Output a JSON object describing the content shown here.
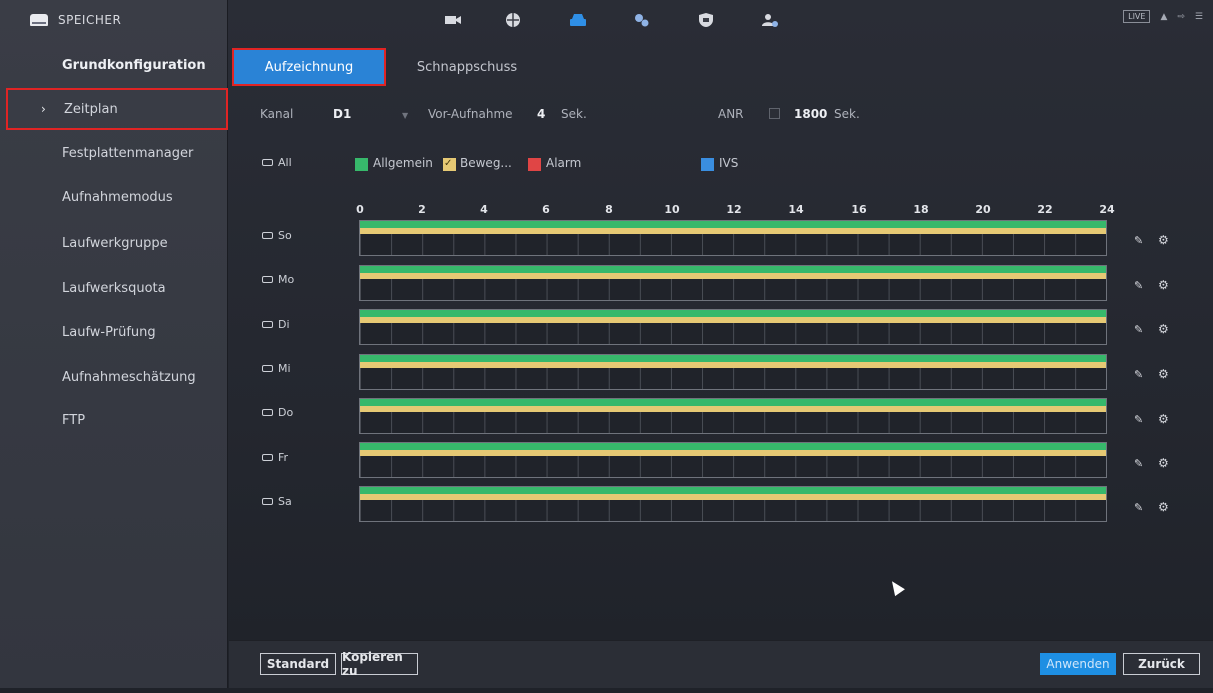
{
  "sidebar": {
    "section_title": "SPEICHER",
    "items": [
      {
        "label": "Grundkonfiguration"
      },
      {
        "label": "Zeitplan"
      },
      {
        "label": "Festplattenmanager"
      },
      {
        "label": "Aufnahmemodus"
      },
      {
        "label": "Laufwerkgruppe"
      },
      {
        "label": "Laufwerksquota"
      },
      {
        "label": "Laufw-Prüfung"
      },
      {
        "label": "Aufnahmeschätzung"
      },
      {
        "label": "FTP"
      }
    ],
    "active_chevron": "›"
  },
  "topbar": {
    "icons": [
      "camera-icon",
      "network-icon",
      "storage-icon",
      "system-settings-icon",
      "security-shield-icon",
      "account-icon"
    ],
    "live_label": "LIVE",
    "right_icons": [
      "user-icon",
      "logout-icon",
      "menu-icon"
    ]
  },
  "tabs": [
    {
      "label": "Aufzeichnung",
      "active": true
    },
    {
      "label": "Schnappschuss",
      "active": false
    }
  ],
  "options": {
    "kanal_label": "Kanal",
    "kanal_value": "D1",
    "pre_record_label": "Vor-Aufnahme",
    "pre_record_value": "4",
    "pre_record_unit": "Sek.",
    "anr_label": "ANR",
    "anr_value": "1800",
    "anr_unit": "Sek."
  },
  "legend": {
    "all_label": "All",
    "items": [
      {
        "label": "Allgemein",
        "color": "#37b86b"
      },
      {
        "label": "Beweg...",
        "color": "#e6c974"
      },
      {
        "label": "Alarm",
        "color": "#e04545"
      },
      {
        "label": "IVS",
        "color": "#3a8ee0"
      }
    ]
  },
  "hours": [
    "0",
    "2",
    "4",
    "6",
    "8",
    "10",
    "12",
    "14",
    "16",
    "18",
    "20",
    "22",
    "24"
  ],
  "days": [
    {
      "label": "So"
    },
    {
      "label": "Mo"
    },
    {
      "label": "Di"
    },
    {
      "label": "Mi"
    },
    {
      "label": "Do"
    },
    {
      "label": "Fr"
    },
    {
      "label": "Sa"
    }
  ],
  "buttons": {
    "standard": "Standard",
    "copy": "Kopieren zu",
    "apply": "Anwenden",
    "back": "Zurück"
  },
  "colors": {
    "accent": "#2a83d6",
    "highlight": "#e02424"
  }
}
